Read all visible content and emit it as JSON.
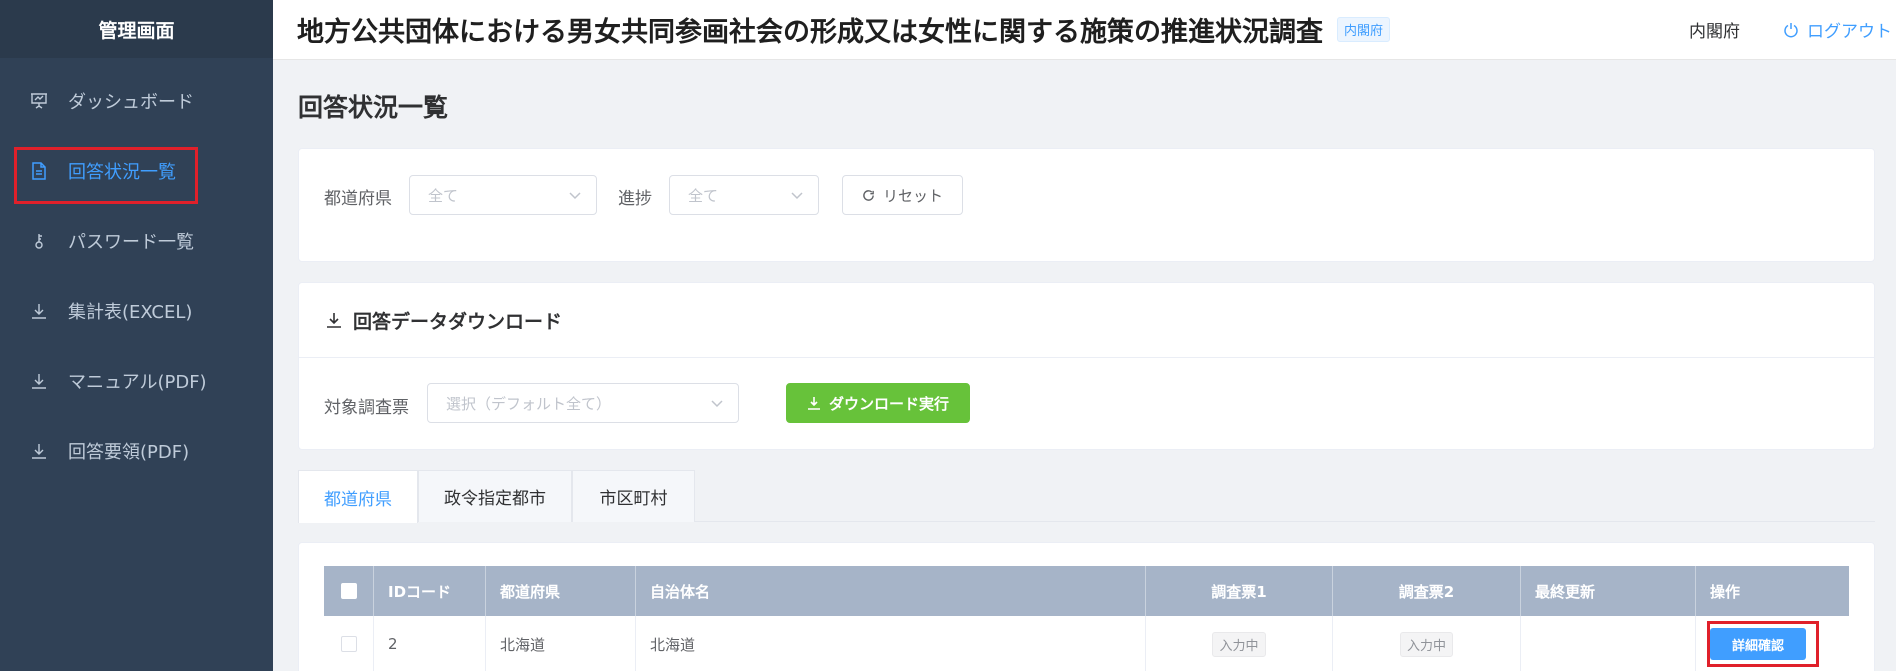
{
  "sidebar": {
    "title": "管理画面",
    "items": [
      {
        "label": "ダッシュボード",
        "icon": "presentation-icon"
      },
      {
        "label": "回答状況一覧",
        "icon": "document-icon"
      },
      {
        "label": "パスワード一覧",
        "icon": "key-icon"
      },
      {
        "label": "集計表(EXCEL)",
        "icon": "download-icon"
      },
      {
        "label": "マニュアル(PDF)",
        "icon": "download-icon"
      },
      {
        "label": "回答要領(PDF)",
        "icon": "download-icon"
      }
    ],
    "active_index": 1
  },
  "header": {
    "title": "地方公共団体における男女共同参画社会の形成又は女性に関する施策の推進状況調査",
    "tag": "内閣府",
    "user": "内閣府",
    "logout": "ログアウト"
  },
  "page": {
    "title": "回答状況一覧"
  },
  "filter": {
    "prefecture_label": "都道府県",
    "prefecture_value": "全て",
    "progress_label": "進捗",
    "progress_value": "全て",
    "reset_label": "リセット"
  },
  "download": {
    "heading": "回答データダウンロード",
    "target_label": "対象調査票",
    "target_placeholder": "選択（デフォルト全て）",
    "execute_label": "ダウンロード実行"
  },
  "tabs": [
    {
      "label": "都道府県",
      "active": true
    },
    {
      "label": "政令指定都市",
      "active": false
    },
    {
      "label": "市区町村",
      "active": false
    }
  ],
  "table": {
    "columns": [
      "IDコード",
      "都道府県",
      "自治体名",
      "調査票1",
      "調査票2",
      "最終更新",
      "操作"
    ],
    "rows": [
      {
        "id": "2",
        "prefecture": "北海道",
        "municipality": "北海道",
        "survey1": "入力中",
        "survey2": "入力中",
        "updated": "",
        "action": "詳細確認"
      }
    ]
  },
  "colors": {
    "sidebar_bg": "#304156",
    "accent": "#409eff",
    "success": "#67c23a",
    "highlight": "#e0202a"
  }
}
